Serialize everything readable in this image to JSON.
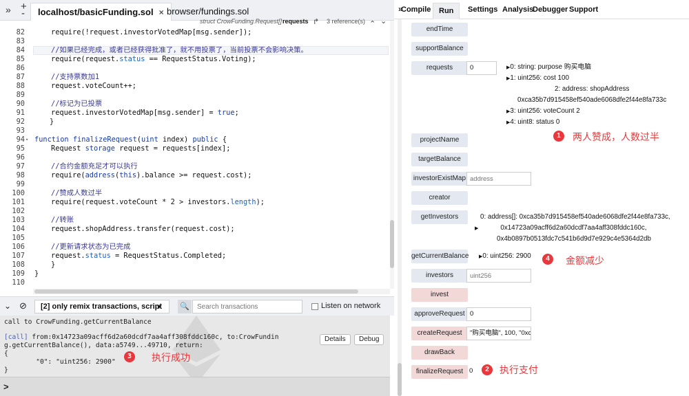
{
  "tabbar": {
    "toggle_left": "»",
    "zoom_in": "+",
    "zoom_out": "-",
    "tabs": [
      {
        "label": "localhost/basicFunding.sol",
        "close": "×"
      },
      {
        "label": "browser/fundings.sol"
      }
    ]
  },
  "editor_header": {
    "struct": "struct CrowFunding.Request[]",
    "name": "requests",
    "go_icon": "↱",
    "refs": "3 reference(s)",
    "up": "⌃",
    "down": "⌄"
  },
  "code": {
    "line_numbers": [
      "82",
      "83",
      "84",
      "85",
      "86",
      "87",
      "88",
      "89",
      "90",
      "91",
      "92",
      "93",
      "94",
      "95",
      "96",
      "97",
      "98",
      "99",
      "100",
      "101",
      "102",
      "103",
      "104",
      "105",
      "106",
      "107",
      "108",
      "109",
      "110"
    ],
    "fold_marker": "▾"
  },
  "terminal_bar": {
    "collapse_icon": "⌄",
    "clear_icon": "⊘",
    "filter": "[2] only remix transactions, script",
    "filter_caret": "▾",
    "search_icon": "🔍",
    "search_placeholder": "Search transactions",
    "listen": "Listen on network"
  },
  "terminal": {
    "call_line": "call to CrowFunding.getCurrentBalance",
    "tag": "[call]",
    "detail_1": " from:0x14723a09acff6d2a60dcdf7aa4aff308fddc160c, to:CrowFundin",
    "detail_2": "g.getCurrentBalance(), data:a5749...49710, return:",
    "brace_open": "{",
    "return_value": "        \"0\": \"uint256: 2900\"",
    "brace_close": "}",
    "details_btn": "Details",
    "debug_btn": "Debug",
    "prompt": ">"
  },
  "right_tabs": {
    "chevron": "»",
    "items": [
      "Compile",
      "Run",
      "Settings",
      "Analysis",
      "Debugger",
      "Support"
    ]
  },
  "functions": {
    "endTime": "endTime",
    "supportBalance": "supportBalance",
    "requests": {
      "label": "requests",
      "value": "0"
    },
    "projectName": "projectName",
    "targetBalance": "targetBalance",
    "investorExistMap": {
      "label": "investorExistMap",
      "placeholder": "address"
    },
    "creator": "creator",
    "getInvestors": "getInvestors",
    "getCurrentBalance": "getCurrentBalance",
    "investors": {
      "label": "investors",
      "placeholder": "uint256"
    },
    "invest": "invest",
    "approveRequest": {
      "label": "approveRequest",
      "value": "0"
    },
    "createRequest": {
      "label": "createRequest",
      "value": "\"购买电脑\", 100, \"0xca"
    },
    "drawBack": "drawBack",
    "finalizeRequest": {
      "label": "finalizeRequest",
      "value": "0"
    }
  },
  "outputs": {
    "requests": [
      "0: string: purpose 购买电脑",
      "1: uint256: cost 100",
      "2: address: shopAddress",
      "0xca35b7d915458ef540ade6068dfe2f44e8fa733c",
      "3: uint256: voteCount 2",
      "4: uint8: status 0"
    ],
    "getInvestors": [
      "0: address[]: 0xca35b7d915458ef540ade6068dfe2f44e8fa733c,",
      "0x14723a09acff6d2a60dcdf7aa4aff308fddc160c,",
      "0x4b0897b0513fdc7c541b6d9d7e929c4e5364d2db"
    ],
    "getCurrentBalance": "0: uint256: 2900"
  },
  "annotations": [
    {
      "num": "1",
      "text": "两人赞成，人数过半"
    },
    {
      "num": "2",
      "text": "执行支付"
    },
    {
      "num": "3",
      "text": "执行成功"
    },
    {
      "num": "4",
      "text": "金额减少"
    }
  ],
  "colors": {
    "accent_red": "#e8383d",
    "function_button": "#e3e8f1",
    "payable_button": "#f3d8d8"
  }
}
